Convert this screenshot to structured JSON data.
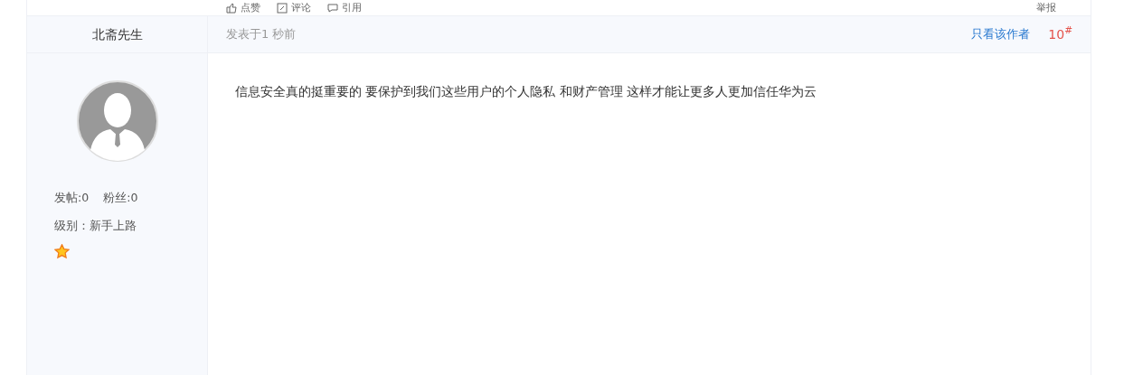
{
  "actions": [
    {
      "kind": "like",
      "label": "点赞"
    },
    {
      "kind": "comment",
      "label": "评论"
    },
    {
      "kind": "quote",
      "label": "引用"
    }
  ],
  "report": "举报",
  "author": {
    "name": "北斋先生",
    "posts": "发帖:0",
    "fans": "粉丝:0",
    "level": "级别：新手上路"
  },
  "post": {
    "time": "发表于1 秒前",
    "only_author": "只看该作者",
    "floor": "10",
    "floor_mark": "#",
    "content": "信息安全真的挺重要的  要保护到我们这些用户的个人隐私 和财产管理 这样才能让更多人更加信任华为云"
  }
}
